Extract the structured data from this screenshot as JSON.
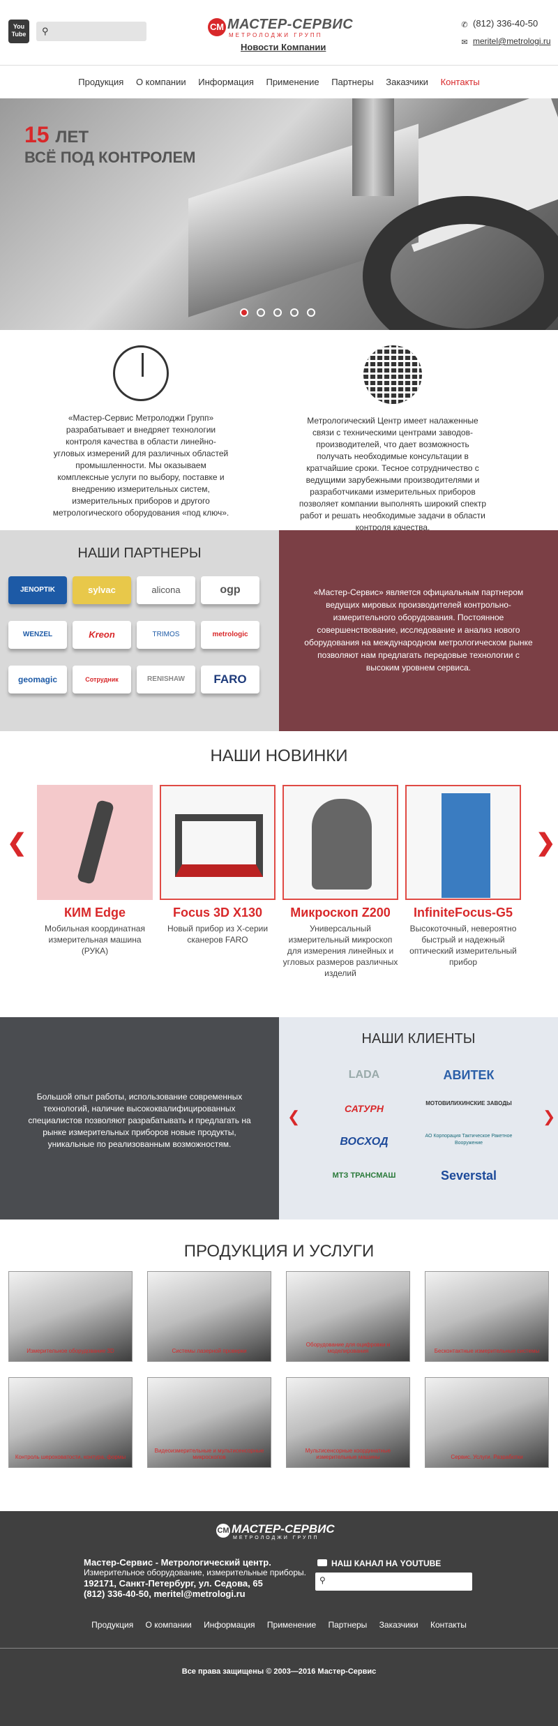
{
  "header": {
    "youtube_label": "You Tube",
    "logo_mark": "СМ",
    "logo_title": "МАСТЕР-СЕРВИС",
    "logo_subtitle": "МЕТРОЛОДЖИ ГРУПП",
    "news_link": "Новости Компании",
    "phone": "(812) 336-40-50",
    "email": "meritel@metrologi.ru"
  },
  "nav": [
    "Продукция",
    "О компании",
    "Информация",
    "Применение",
    "Партнеры",
    "Заказчики",
    "Контакты"
  ],
  "hero": {
    "number": "15",
    "years": "ЛЕТ",
    "tagline": "ВСЁ ПОД КОНТРОЛЕМ"
  },
  "about": {
    "left": "«Мастер-Сервис Метролоджи Групп» разрабатывает и внедряет технологии контроля качества в области линейно-угловых измерений для различных областей промышленности. Мы оказываем комплексные услуги по выбору, поставке и внедрению измерительных систем, измерительных приборов и другого метрологического оборудования «под ключ».",
    "right": "Метрологический Центр имеет налаженные связи с техническими центрами заводов-производителей, что дает возможность получать необходимые консультации в кратчайшие сроки. Тесное сотрудничество с ведущими зарубежными производителями и разработчиками измерительных приборов позволяет компании выполнять широкий спектр работ и решать необходимые задачи в области контроля качества."
  },
  "partners": {
    "title": "НАШИ ПАРТНЕРЫ",
    "logos": [
      "JENOPTIK",
      "sylvac",
      "alicona",
      "ogp",
      "WENZEL",
      "Kreon",
      "TRIMOS",
      "metrologic",
      "geomagic",
      "Сотрудник",
      "RENISHAW",
      "FARO"
    ],
    "text": "«Мастер-Сервис» является официальным партнером ведущих мировых производителей контрольно-измерительного оборудования. Постоянное совершенствование, исследование и анализ нового оборудования на международном метрологическом рынке позволяют нам предлагать передовые технологии с высоким уровнем сервиса."
  },
  "novelties": {
    "title": "НАШИ НОВИНКИ",
    "items": [
      {
        "name": "КИМ Edge",
        "desc": "Мобильная координатная измерительная машина (РУКА)"
      },
      {
        "name": "Focus 3D X130",
        "desc": "Новый прибор из X-серии сканеров FARO"
      },
      {
        "name": "Микроскоп Z200",
        "desc": "Универсальный измерительный микроскоп для измерения линейных и угловых размеров различных изделий"
      },
      {
        "name": "InfiniteFocus-G5",
        "desc": "Высокоточный, невероятно быстрый и надежный оптический измерительный прибор"
      }
    ]
  },
  "clients": {
    "intro": "Большой опыт работы, использование современных технологий, наличие высококвалифицированных специалистов позволяют разрабатывать и предлагать на рынке измерительных приборов новые продукты, уникальные по реализованным возможностям.",
    "title": "НАШИ КЛИЕНТЫ",
    "logos": [
      "LADA",
      "АВИТЕК",
      "САТУРН",
      "МОТОВИЛИХИНСКИЕ ЗАВОДЫ",
      "ВОСХОД",
      "АО Корпорация Тактическое Ракетное Вооружение",
      "МТЗ ТРАНСМАШ",
      "Severstal"
    ]
  },
  "products": {
    "title": "ПРОДУКЦИЯ И УСЛУГИ",
    "items": [
      "Измерительное оборудование 3D",
      "Системы лазерной проверки",
      "Оборудование для оцифровки и моделирования",
      "Бесконтактные измерительные системы",
      "Контроль шероховатости, контура, формы",
      "Видеоизмерительные и мультисенсорные микроскопов",
      "Мультисенсорные координатные измерительные машины",
      "Сервис. Услуги. Разработки"
    ]
  },
  "footer": {
    "logo_mark": "СМ",
    "logo_title": "МАСТЕР-СЕРВИС",
    "logo_subtitle": "МЕТРОЛОДЖИ ГРУПП",
    "company": "Мастер-Сервис - Метрологический центр.",
    "line2": "Измерительное оборудование, измерительные приборы.",
    "address": "192171, Санкт-Петербург, ул. Седова, 65",
    "contacts": "(812) 336-40-50, meritel@metrologi.ru",
    "youtube": "НАШ КАНАЛ НА YOUTUBE",
    "nav": [
      "Продукция",
      "О компании",
      "Информация",
      "Применение",
      "Партнеры",
      "Заказчики",
      "Контакты"
    ],
    "copyright": "Все права защищены © 2003—2016 Мастер-Сервис"
  },
  "colors": {
    "accent": "#d8282a",
    "partners_panel": "#7b3f45",
    "dark_panel": "#4a4c50",
    "footer": "#404040"
  }
}
